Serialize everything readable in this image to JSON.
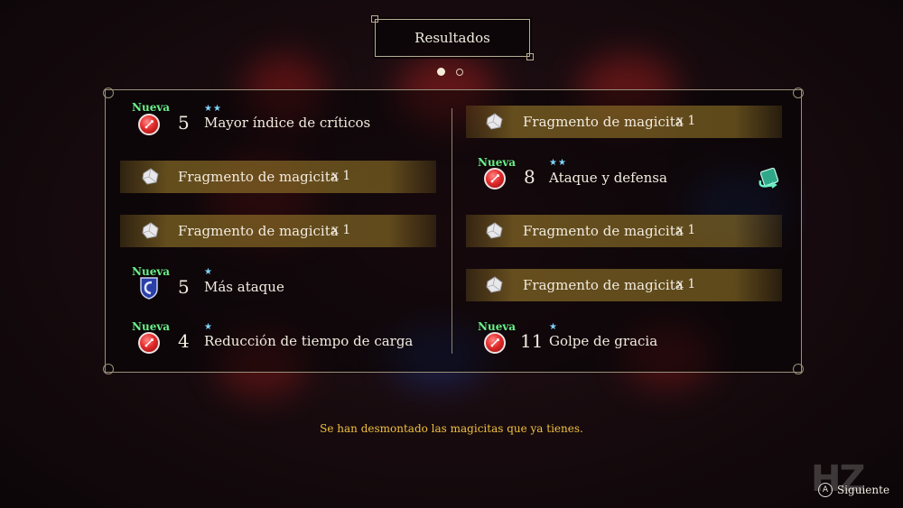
{
  "header": {
    "title": "Resultados"
  },
  "pagination": {
    "current": 1,
    "total": 2
  },
  "left_column": [
    {
      "type": "materia",
      "badge": "Nueva",
      "level": "5",
      "stars": "★★",
      "name": "Mayor índice de críticos",
      "icon": "red-materia-icon"
    },
    {
      "type": "fragment",
      "name": "Fragmento de magicita",
      "qty": "x 1",
      "icon": "crystal-fragment-icon"
    },
    {
      "type": "fragment",
      "name": "Fragmento de magicita",
      "qty": "x 1",
      "icon": "crystal-fragment-icon"
    },
    {
      "type": "materia",
      "badge": "Nueva",
      "level": "5",
      "stars": "★",
      "name": "Más ataque",
      "icon": "blue-shield-materia-icon"
    },
    {
      "type": "materia",
      "badge": "Nueva",
      "level": "4",
      "stars": "★",
      "name": "Reducción de tiempo de carga",
      "icon": "red-materia-icon"
    }
  ],
  "right_column": [
    {
      "type": "fragment",
      "name": "Fragmento de magicita",
      "qty": "x 1",
      "icon": "crystal-fragment-icon"
    },
    {
      "type": "materia",
      "badge": "Nueva",
      "level": "8",
      "stars": "★★",
      "name": "Ataque y defensa",
      "icon": "red-materia-icon"
    },
    {
      "type": "fragment",
      "name": "Fragmento de magicita",
      "qty": "x 1",
      "icon": "crystal-fragment-icon"
    },
    {
      "type": "fragment",
      "name": "Fragmento de magicita",
      "qty": "x 1",
      "icon": "crystal-fragment-icon"
    },
    {
      "type": "materia",
      "badge": "Nueva",
      "level": "11",
      "stars": "★",
      "name": "Golpe de gracia",
      "icon": "red-materia-icon"
    }
  ],
  "message": "Se han desmontado las magicitas que ya tienes.",
  "next_button": {
    "key": "A",
    "label": "Siguiente"
  },
  "watermark": "HZ",
  "colors": {
    "new_badge": "#6bf08a",
    "stars": "#7fd4ff",
    "message": "#f0c040",
    "banner": "#a8872d"
  }
}
